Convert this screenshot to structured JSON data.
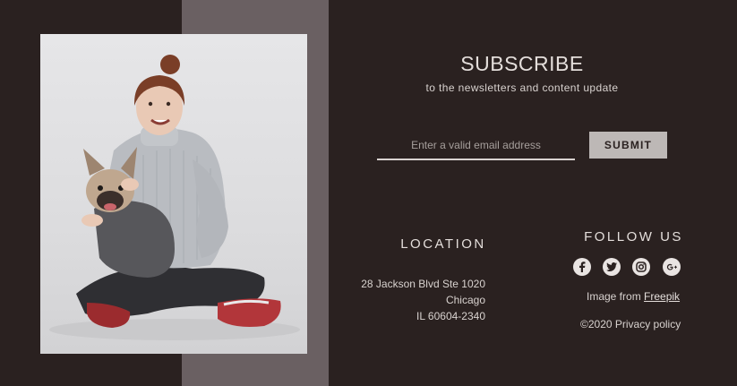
{
  "subscribe": {
    "title": "SUBSCRIBE",
    "subtitle": "to the newsletters and content update",
    "email_placeholder": "Enter a valid email address",
    "submit_label": "SUBMIT"
  },
  "location": {
    "title": "LOCATION",
    "line1": "28 Jackson Blvd Ste 1020",
    "line2": "Chicago",
    "line3": "IL 60604-2340"
  },
  "follow": {
    "title": "FOLLOW US",
    "icons": [
      "facebook-icon",
      "twitter-icon",
      "instagram-icon",
      "google-plus-icon"
    ],
    "image_credit_prefix": "Image from",
    "image_credit_link": "Freepik",
    "copyright": "©2020 Privacy policy"
  },
  "colors": {
    "background": "#2a2120",
    "band": "#6a6062",
    "submit_bg": "#bdb8b6"
  }
}
